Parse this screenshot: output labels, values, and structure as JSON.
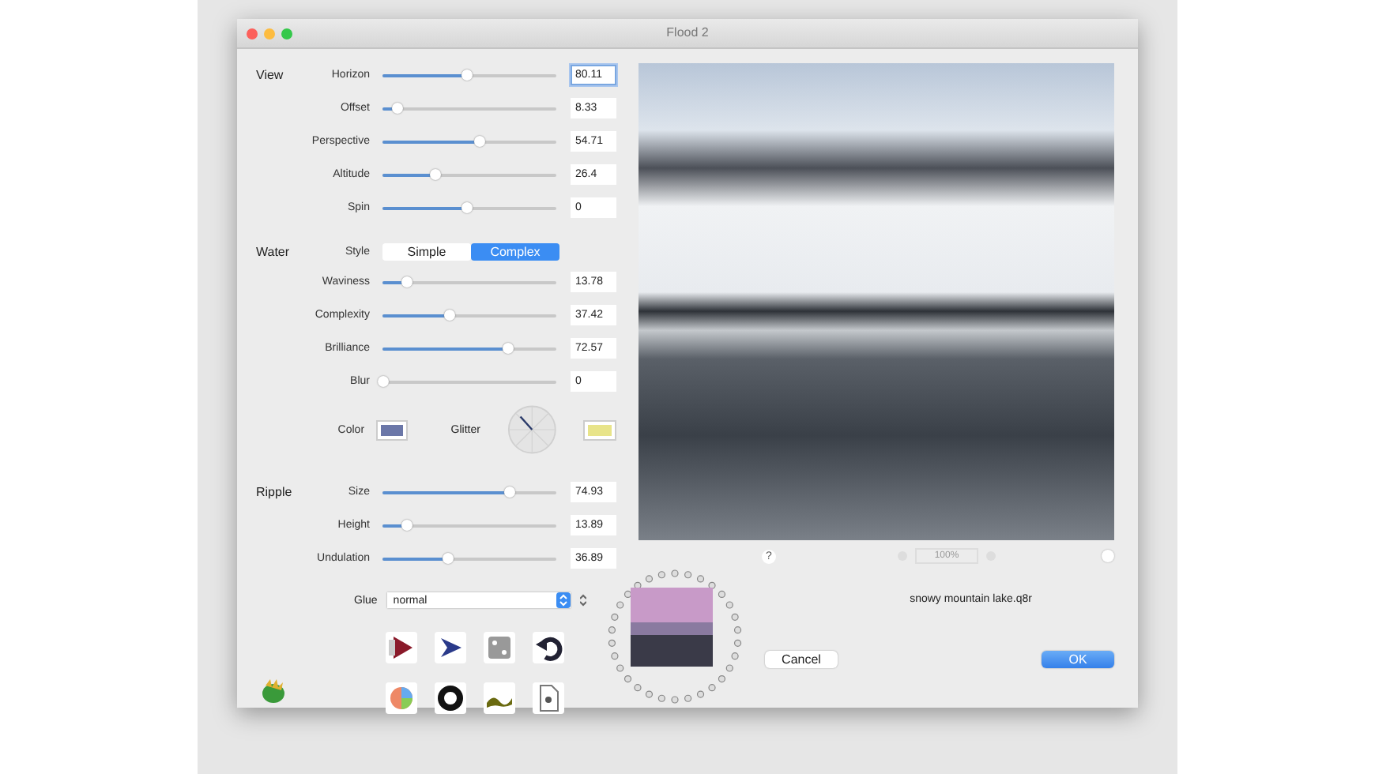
{
  "window": {
    "title": "Flood 2"
  },
  "sections": [
    {
      "title": "View",
      "rows": [
        {
          "kind": "slider",
          "label": "Horizon",
          "level": 0.48,
          "value": "80.11",
          "focused": true
        },
        {
          "kind": "slider",
          "label": "Offset",
          "level": 0.08,
          "value": "8.33",
          "focused": false
        },
        {
          "kind": "slider",
          "label": "Perspective",
          "level": 0.55,
          "value": "54.71",
          "focused": false
        },
        {
          "kind": "slider",
          "label": "Altitude",
          "level": 0.3,
          "value": "26.4",
          "focused": false
        },
        {
          "kind": "slider",
          "label": "Spin",
          "level": 0.48,
          "value": "0",
          "focused": false
        }
      ]
    },
    {
      "title": "Water",
      "rows": [
        {
          "kind": "segmented",
          "label": "Style",
          "options": [
            {
              "label": "Simple",
              "selected": false
            },
            {
              "label": "Complex",
              "selected": true
            }
          ]
        },
        {
          "kind": "slider",
          "label": "Waviness",
          "level": 0.14,
          "value": "13.78",
          "focused": false
        },
        {
          "kind": "slider",
          "label": "Complexity",
          "level": 0.38,
          "value": "37.42",
          "focused": false
        },
        {
          "kind": "slider",
          "label": "Brilliance",
          "level": 0.72,
          "value": "72.57",
          "focused": false
        },
        {
          "kind": "slider",
          "label": "Blur",
          "level": 0,
          "value": "0",
          "focused": false
        },
        {
          "kind": "colors",
          "label": "Color",
          "color": "#6b77a8",
          "glitter": {
            "label": "Glitter",
            "color": "#e8e48a"
          }
        }
      ]
    },
    {
      "title": "Ripple",
      "rows": [
        {
          "kind": "slider",
          "label": "Size",
          "level": 0.73,
          "value": "74.93",
          "focused": false
        },
        {
          "kind": "slider",
          "label": "Height",
          "level": 0.14,
          "value": "13.89",
          "focused": false
        },
        {
          "kind": "slider",
          "label": "Undulation",
          "level": 0.37,
          "value": "36.89",
          "focused": false
        }
      ]
    }
  ],
  "glue": {
    "label": "Glue",
    "value": "normal"
  },
  "preview": {
    "help": "?",
    "zoom": "100%",
    "filename": "snowy mountain lake.q8r"
  },
  "buttons": [
    {
      "label": "Cancel",
      "default": false
    },
    {
      "label": "OK",
      "default": true
    }
  ]
}
